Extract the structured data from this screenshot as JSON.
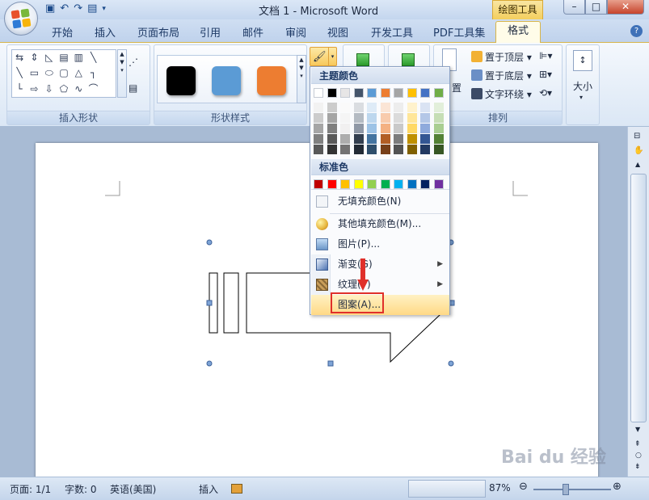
{
  "window": {
    "title": "文档 1 - Microsoft Word",
    "contextual_tab": "绘图工具",
    "min": "–",
    "max": "□",
    "close": "✕"
  },
  "tabs": [
    "开始",
    "插入",
    "页面布局",
    "引用",
    "邮件",
    "审阅",
    "视图",
    "开发工具",
    "PDF工具集"
  ],
  "active_tab": "格式",
  "ribbon": {
    "group_insert_shapes": "插入形状",
    "group_shape_styles": "形状样式",
    "group_arrange": "排列",
    "bring_front": "置于顶层",
    "send_back": "置于底层",
    "text_wrap": "文字环绕",
    "position_label": "置",
    "size_label": "大小",
    "shape_style_colors": [
      "#000000",
      "#5b9bd5",
      "#ed7d31"
    ]
  },
  "fill_menu": {
    "theme_header": "主题颜色",
    "standard_header": "标准色",
    "theme_colors": [
      "#ffffff",
      "#000000",
      "#e7e6e6",
      "#44546a",
      "#5b9bd5",
      "#ed7d31",
      "#a5a5a5",
      "#ffc000",
      "#4472c4",
      "#70ad47"
    ],
    "standard_colors": [
      "#c00000",
      "#ff0000",
      "#ffc000",
      "#ffff00",
      "#92d050",
      "#00b050",
      "#00b0f0",
      "#0070c0",
      "#002060",
      "#7030a0"
    ],
    "no_fill": "无填充颜色(N)",
    "more_colors": "其他填充颜色(M)...",
    "picture": "图片(P)...",
    "gradient": "渐变(G)",
    "texture": "纹理(T)",
    "pattern": "图案(A)..."
  },
  "status": {
    "page": "页面: 1/1",
    "words": "字数: 0",
    "language": "英语(美国)",
    "mode": "插入",
    "zoom": "87%"
  },
  "watermark": "Bai du 经验"
}
